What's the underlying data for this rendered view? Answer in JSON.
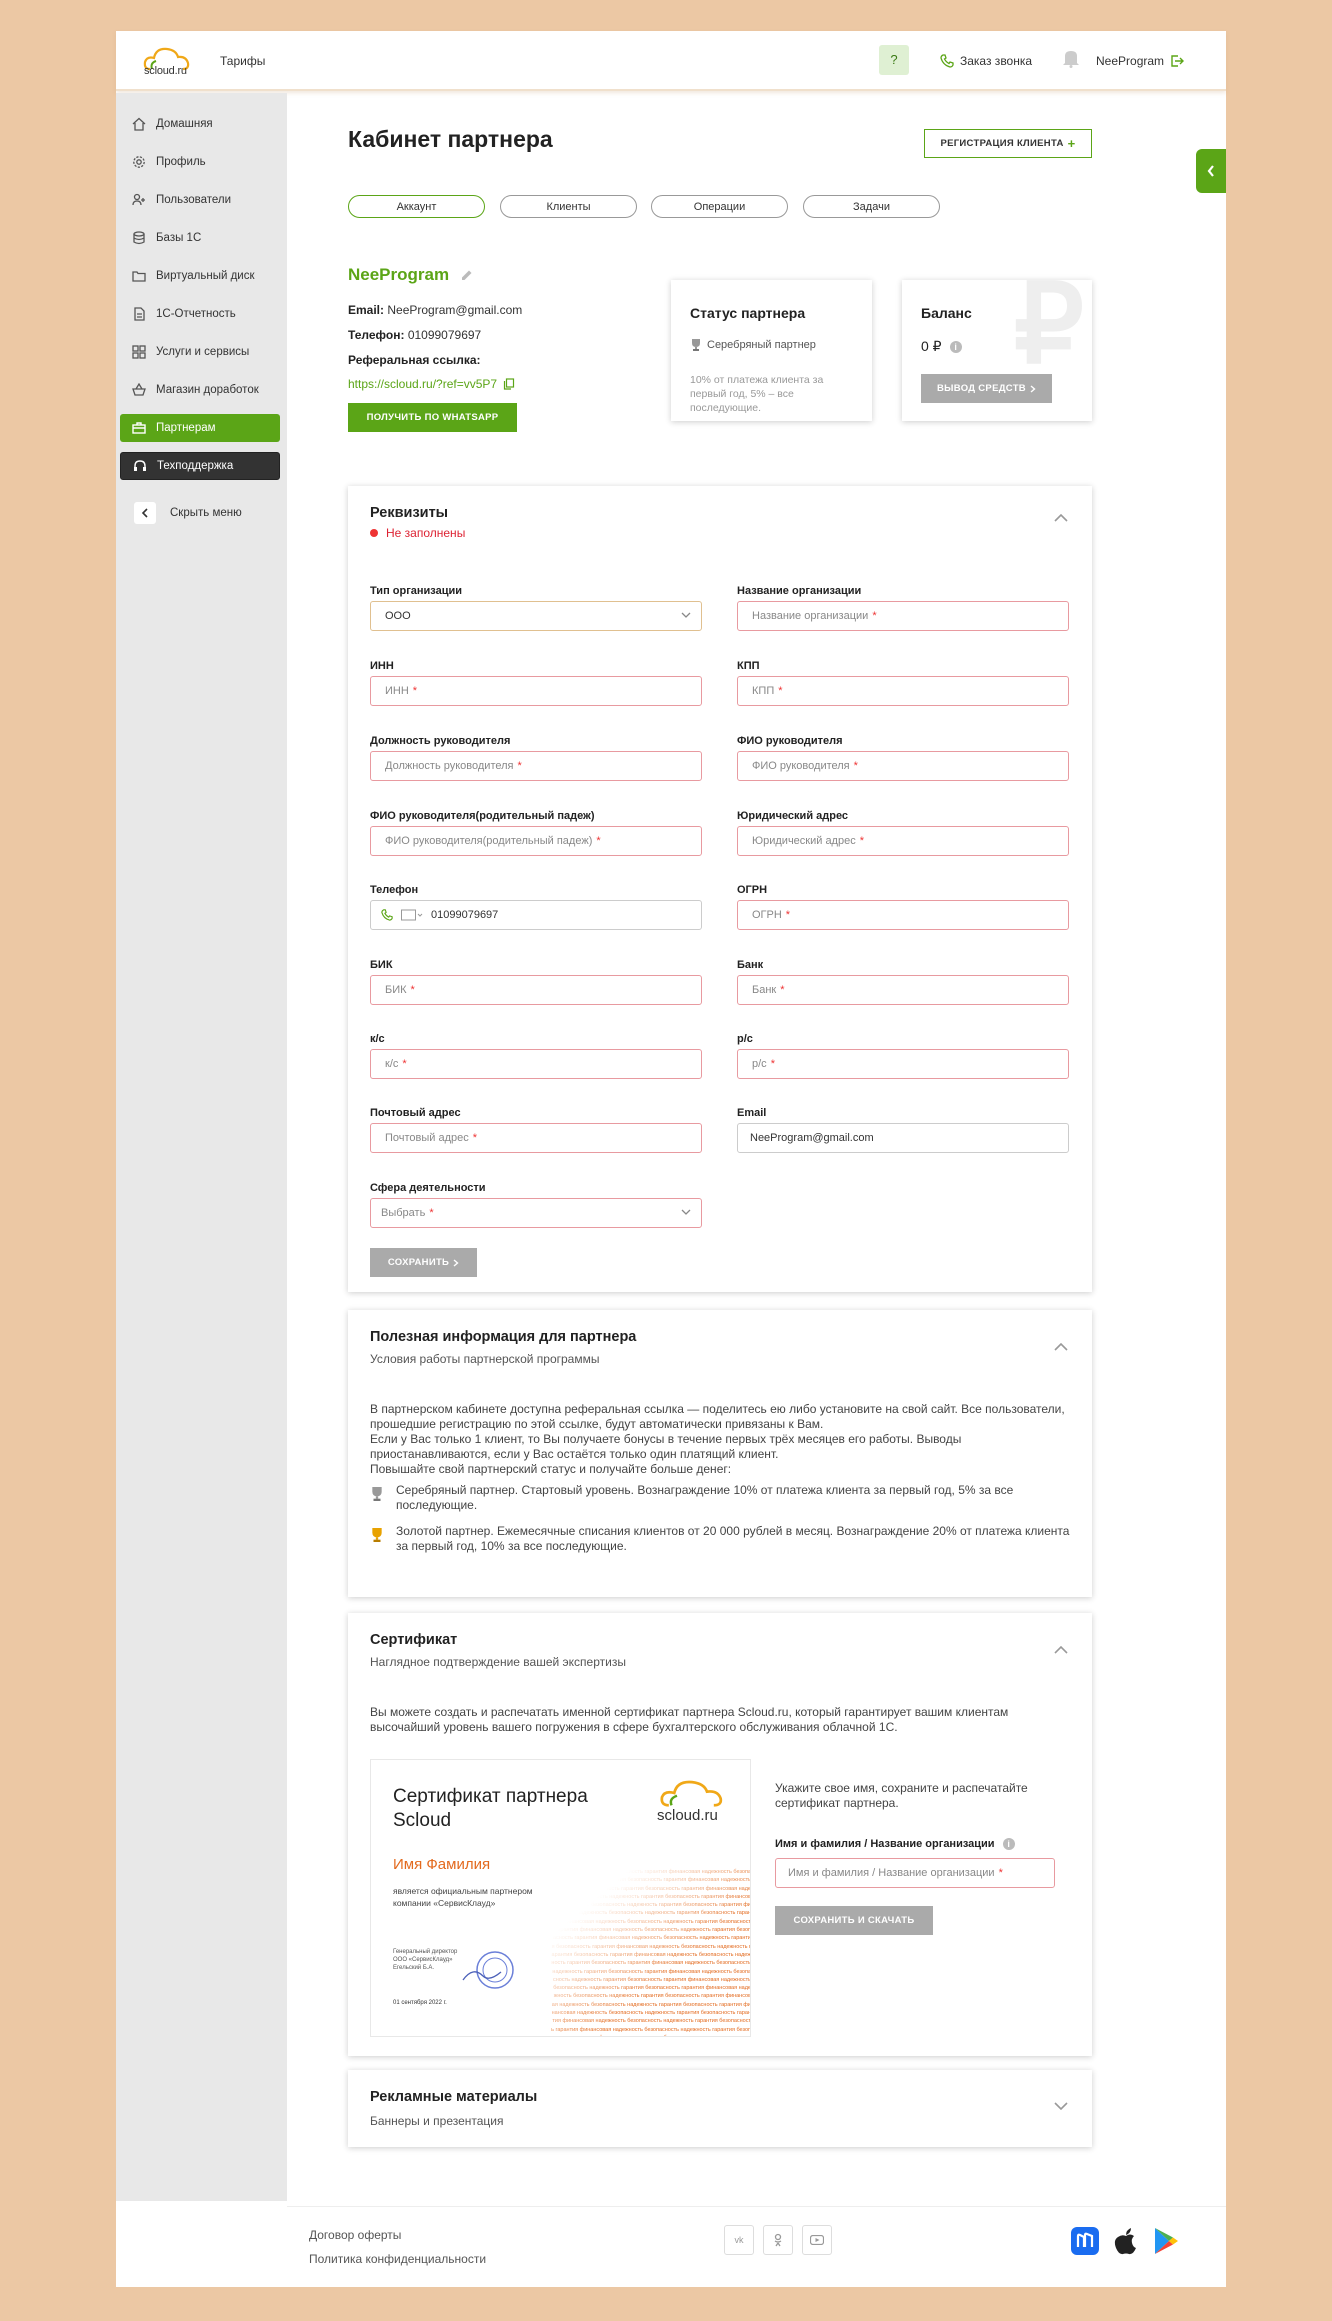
{
  "topbar": {
    "logo_text": "scloud.ru",
    "tarif": "Тарифы",
    "help": "?",
    "call": "Заказ звонка",
    "user": "NeeProgram"
  },
  "sidebar": {
    "items": [
      {
        "label": "Домашняя",
        "icon": "home-icon"
      },
      {
        "label": "Профиль",
        "icon": "gear-icon"
      },
      {
        "label": "Пользователи",
        "icon": "add-user-icon"
      },
      {
        "label": "Базы 1С",
        "icon": "database-icon"
      },
      {
        "label": "Виртуальный диск",
        "icon": "folder-icon"
      },
      {
        "label": "1С-Отчетность",
        "icon": "document-icon"
      },
      {
        "label": "Услуги и сервисы",
        "icon": "grid-icon"
      },
      {
        "label": "Магазин доработок",
        "icon": "basket-icon"
      },
      {
        "label": "Партнерам",
        "icon": "briefcase-icon"
      },
      {
        "label": "Техподдержка",
        "icon": "headset-icon"
      }
    ],
    "hide": "Скрыть меню"
  },
  "page": {
    "title": "Кабинет партнера",
    "register_btn": "РЕГИСТРАЦИЯ КЛИЕНТА",
    "tabs": [
      "Аккаунт",
      "Клиенты",
      "Операции",
      "Задачи"
    ]
  },
  "partner": {
    "name": "NeeProgram",
    "email_label": "Email:",
    "email": "NeeProgram@gmail.com",
    "phone_label": "Телефон:",
    "phone": "01099079697",
    "ref_label": "Реферальная ссылка:",
    "ref_link": "https://scloud.ru/?ref=vv5P7",
    "whatsapp_btn": "ПОЛУЧИТЬ ПО WHATSAPP"
  },
  "status_card": {
    "title": "Статус партнера",
    "rank": "Серебряный партнер",
    "note": "10% от платежа клиента за первый год, 5% – все последующие."
  },
  "balance_card": {
    "title": "Баланс",
    "value": "0 ₽",
    "withdraw": "ВЫВОД СРЕДСТВ",
    "bg_symbol": "₽"
  },
  "requisites": {
    "title": "Реквизиты",
    "status": "Не заполнены",
    "fields": [
      {
        "label": "Тип организации",
        "value": "ООО",
        "type": "select"
      },
      {
        "label": "Название организации",
        "placeholder": "Название организации"
      },
      {
        "label": "ИНН",
        "placeholder": "ИНН"
      },
      {
        "label": "КПП",
        "placeholder": "КПП"
      },
      {
        "label": "Должность руководителя",
        "placeholder": "Должность руководителя"
      },
      {
        "label": "ФИО руководителя",
        "placeholder": "ФИО руководителя"
      },
      {
        "label": "ФИО руководителя(родительный падеж)",
        "placeholder": "ФИО руководителя(родительный падеж)"
      },
      {
        "label": "Юридический адрес",
        "placeholder": "Юридический адрес"
      },
      {
        "label": "Телефон",
        "value": "01099079697",
        "type": "phone"
      },
      {
        "label": "ОГРН",
        "placeholder": "ОГРН"
      },
      {
        "label": "БИК",
        "placeholder": "БИК"
      },
      {
        "label": "Банк",
        "placeholder": "Банк"
      },
      {
        "label": "к/с",
        "placeholder": "к/с"
      },
      {
        "label": "р/с",
        "placeholder": "р/с"
      },
      {
        "label": "Почтовый адрес",
        "placeholder": "Почтовый адрес"
      },
      {
        "label": "Email",
        "value": "NeeProgram@gmail.com"
      },
      {
        "label": "Сфера деятельности",
        "placeholder": "Выбрать",
        "type": "select"
      }
    ],
    "save": "СОХРАНИТЬ"
  },
  "info": {
    "title": "Полезная информация для партнера",
    "subtitle": "Условия работы партнерской программы",
    "p1": "В партнерском кабинете доступна реферальная ссылка — поделитесь ею либо установите на свой сайт. Все пользователи, прошедшие регистрацию по этой ссылке, будут автоматически привязаны к Вам.",
    "p2": "Если у Вас только 1 клиент, то Вы получаете бонусы в течение первых трёх месяцев его работы. Выводы приостанавливаются, если у Вас остаётся только один платящий клиент.",
    "p3": "Повышайте свой партнерский статус и получайте больше денег:",
    "silver": "Серебряный партнер. Стартовый уровень. Вознаграждение 10% от платежа клиента за первый год, 5% за все последующие.",
    "gold": "Золотой партнер. Ежемесячные списания клиентов от 20 000 рублей в месяц. Вознаграждение 20% от платежа клиента за первый год, 10% за все последующие."
  },
  "certificate": {
    "title": "Сертификат",
    "subtitle": "Наглядное подтверждение вашей экспертизы",
    "text": "Вы можете создать и распечатать именной сертификат партнера Scloud.ru, который гарантирует вашим клиентам высочайший уровень вашего погружения в сфере бухгалтерского обслуживания облачной 1С.",
    "cert_heading": "Сертификат партнера Scloud",
    "cert_logo": "scloud.ru",
    "cert_name": "Имя Фамилия",
    "cert_line": "является официальным партнером компании «СервисКлауд»",
    "cert_sign": "Генеральный директор ООО «СервисКлауд» Егельский Б.А.",
    "cert_date": "01 сентября 2022 г.",
    "cert_pattern": "надежность гарантия безопасность гарантия финансовая надежность безопасность",
    "right_text": "Укажите свое имя, сохраните и распечатайте сертификат партнера.",
    "field_label": "Имя и фамилия / Название организации",
    "field_placeholder": "Имя и фамилия / Название организации",
    "button": "СОХРАНИТЬ И СКАЧАТЬ"
  },
  "ads": {
    "title": "Рекламные материалы",
    "subtitle": "Баннеры и презентация"
  },
  "footer": {
    "offer": "Договор оферты",
    "privacy": "Политика конфиденциальности",
    "social": [
      "vk-icon",
      "ok-icon",
      "youtube-icon"
    ],
    "apps": [
      "rustore-icon",
      "apple-icon",
      "google-play-icon"
    ]
  },
  "colors": {
    "accent": "#5ba517",
    "error": "#e33333",
    "bg": "#ecc8a4",
    "cert_orange": "#e36a1e"
  }
}
